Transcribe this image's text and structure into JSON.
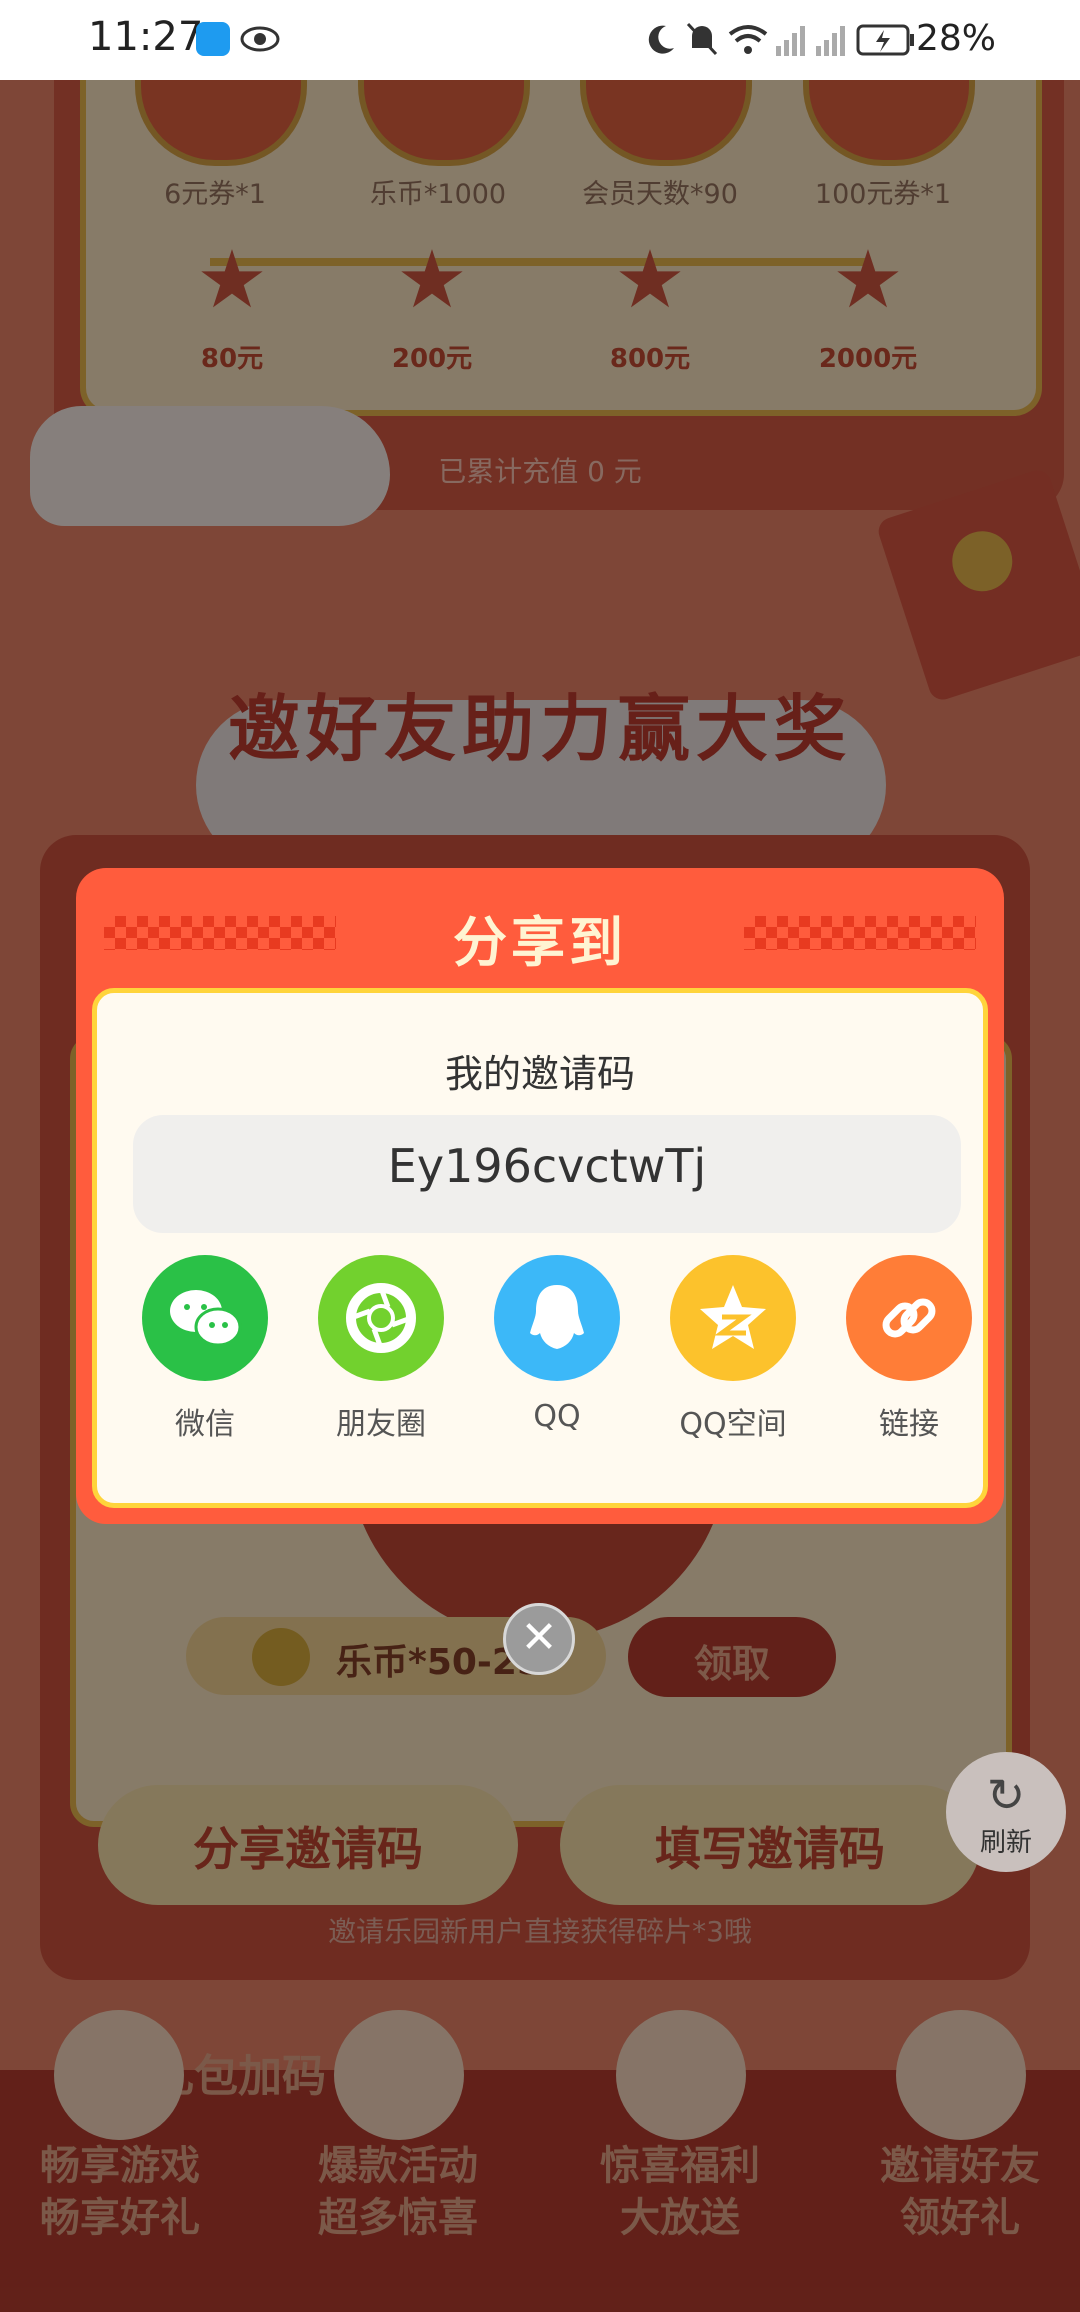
{
  "status_bar": {
    "time": "11:27",
    "battery": "28%"
  },
  "milestones": {
    "rewards": [
      "6元券*1",
      "乐币*1000",
      "会员天数*90",
      "100元券*1"
    ],
    "tiers": [
      "80元",
      "200元",
      "800元",
      "2000元"
    ],
    "recharge_total": "已累计充值 0 元"
  },
  "invite_section": {
    "title": "邀好友助力赢大奖",
    "reward_text": "乐币*50-25",
    "claim_label": "领取",
    "share_code_button": "分享邀请码",
    "enter_code_button": "填写邀请码",
    "note": "邀请乐园新用户直接获得碎片*3哦"
  },
  "refresh": {
    "label": "刷新"
  },
  "share_modal": {
    "title": "分享到",
    "code_label": "我的邀请码",
    "code_value": "Ey196cvctwTj",
    "targets": [
      {
        "label": "微信",
        "icon": "wechat-icon",
        "color": "#2ac147"
      },
      {
        "label": "朋友圈",
        "icon": "moments-icon",
        "color": "#72d12e"
      },
      {
        "label": "QQ",
        "icon": "qq-icon",
        "color": "#3cb8f8"
      },
      {
        "label": "QQ空间",
        "icon": "qzone-icon",
        "color": "#fcc22c"
      },
      {
        "label": "链接",
        "icon": "link-icon",
        "color": "#ff7d37"
      }
    ]
  },
  "bottom_nav": [
    {
      "line1": "畅享游戏",
      "line2": "畅享好礼"
    },
    {
      "line1": "爆款活动",
      "line2": "超多惊喜"
    },
    {
      "line1": "惊喜福利",
      "line2": "大放送"
    },
    {
      "line1": "邀请好友",
      "line2": "领好礼"
    }
  ],
  "banner_text": "礼包加码"
}
